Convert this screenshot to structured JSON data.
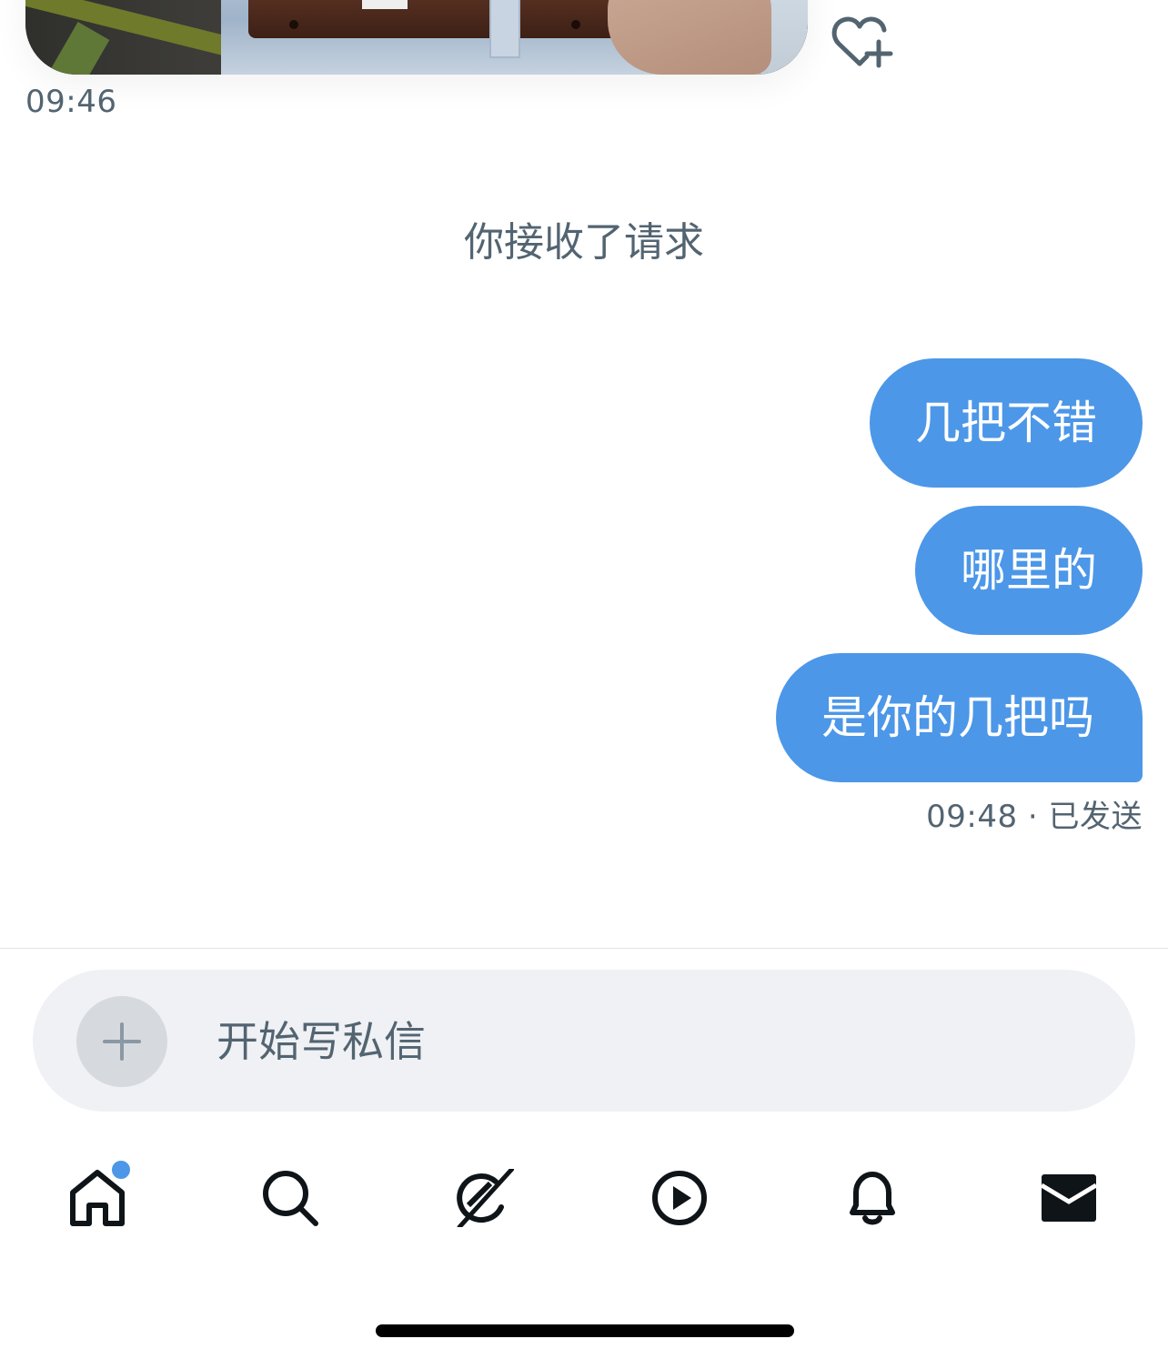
{
  "conversation": {
    "received_image": {
      "alt": "received photo"
    },
    "received_time": "09:46",
    "system_note": "你接收了请求",
    "sent_messages": [
      {
        "text": "几把不错"
      },
      {
        "text": "哪里的"
      },
      {
        "text": "是你的几把吗"
      }
    ],
    "sent_status": "09:48 · 已发送"
  },
  "composer": {
    "placeholder": "开始写私信"
  },
  "bottom_nav": {
    "items": [
      "home-icon",
      "search-icon",
      "grok-icon",
      "video-icon",
      "bell-icon",
      "mail-icon"
    ],
    "has_home_badge": true
  },
  "colors": {
    "accent": "#4c97e8",
    "secondary_text": "#536471",
    "composer_bg": "#eff1f4",
    "voice_gradient_start": "#5b6cf0",
    "voice_gradient_end": "#b054e0"
  }
}
